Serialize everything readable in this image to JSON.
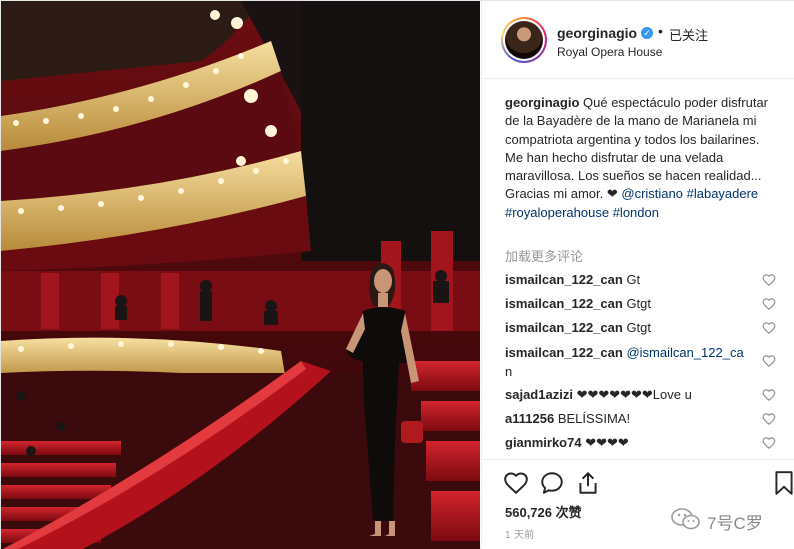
{
  "post": {
    "username": "georginagio",
    "verified_mark": "✓",
    "separator": "•",
    "follow_status": "已关注",
    "location": "Royal Opera House"
  },
  "caption": {
    "username": "georginagio",
    "text": "Qué espectáculo poder disfrutar de la Bayadère de la mano de Marianela mi compatriota argentina y todos los bailarines. Me han hecho disfrutar de una velada maravillosa. Los sueños se hacen realidad... Gracias mi amor. ❤",
    "tags": [
      "@cristiano",
      "#labayadere",
      "#royaloperahouse",
      "#london"
    ]
  },
  "load_more_label": "加载更多评论",
  "comments": [
    {
      "user": "ismailcan_122_can",
      "text": "Gt"
    },
    {
      "user": "ismailcan_122_can",
      "text": "Gtgt"
    },
    {
      "user": "ismailcan_122_can",
      "text": "Gtgt"
    },
    {
      "user": "ismailcan_122_can",
      "mention": "@ismailcan_122_ca",
      "text": "n"
    },
    {
      "user": "sajad1azizi",
      "text": "❤❤❤❤❤❤❤Love u"
    },
    {
      "user": "a111256",
      "text": "BELÍSSIMA!"
    },
    {
      "user": "gianmirko74",
      "text": "❤❤❤❤"
    }
  ],
  "likes": "560,726 次赞",
  "time": "1 天前",
  "watermark": "7号C罗",
  "icons": [
    "heart-icon",
    "comment-icon",
    "share-icon",
    "bookmark-icon"
  ],
  "colors": {
    "link": "#003569",
    "verified": "#3897f0",
    "muted": "#999999",
    "theater_red": "#b3121c"
  }
}
